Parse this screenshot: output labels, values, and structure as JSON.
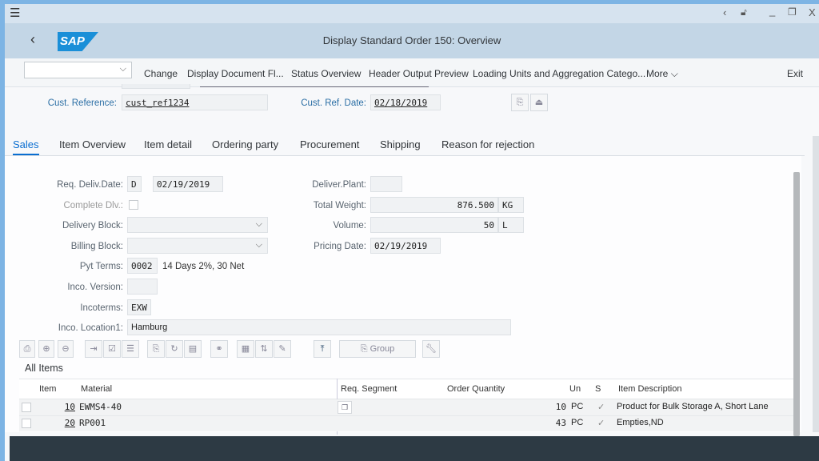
{
  "window": {
    "title": "Display Standard Order 150: Overview",
    "logo": "SAP"
  },
  "toolbar": {
    "dropdown_value": "",
    "items": [
      "Change",
      "Display Document Fl...",
      "Status Overview",
      "Header Output Preview",
      "Loading Units and Aggregation Catego...",
      "More"
    ],
    "exit": "Exit"
  },
  "header_fields": {
    "cust_ref_label": "Cust. Reference:",
    "cust_ref": "cust_ref1234",
    "cust_ref_date_label": "Cust. Ref. Date:",
    "cust_ref_date": "02/18/2019"
  },
  "tabs": [
    "Sales",
    "Item Overview",
    "Item detail",
    "Ordering party",
    "Procurement",
    "Shipping",
    "Reason for rejection"
  ],
  "sales": {
    "req_deliv_label": "Req. Deliv.Date:",
    "req_deliv_type": "D",
    "req_deliv_date": "02/19/2019",
    "complete_dlv_label": "Complete Dlv.:",
    "delivery_block_label": "Delivery Block:",
    "billing_block_label": "Billing Block:",
    "pyt_terms_label": "Pyt Terms:",
    "pyt_terms": "0002",
    "pyt_terms_desc": "14 Days 2%, 30 Net",
    "inco_version_label": "Inco. Version:",
    "incoterms_label": "Incoterms:",
    "incoterms": "EXW",
    "inco_location_label": "Inco. Location1:",
    "inco_location": "Hamburg",
    "deliver_plant_label": "Deliver.Plant:",
    "total_weight_label": "Total Weight:",
    "total_weight": "876.500",
    "weight_unit": "KG",
    "volume_label": "Volume:",
    "volume": "50",
    "volume_unit": "L",
    "pricing_date_label": "Pricing Date:",
    "pricing_date": "02/19/2019"
  },
  "items": {
    "group_button": "Group",
    "title": "All Items",
    "columns": [
      "Item",
      "Material",
      "Req. Segment",
      "Order Quantity",
      "Un",
      "S",
      "Item Description"
    ],
    "rows": [
      {
        "item": "10",
        "material": "EWMS4-40",
        "qty": "10",
        "un": "PC",
        "desc": "Product for Bulk Storage A, Short Lane"
      },
      {
        "item": "20",
        "material": "RP001",
        "qty": "43",
        "un": "PC",
        "desc": "Empties,ND"
      }
    ]
  }
}
